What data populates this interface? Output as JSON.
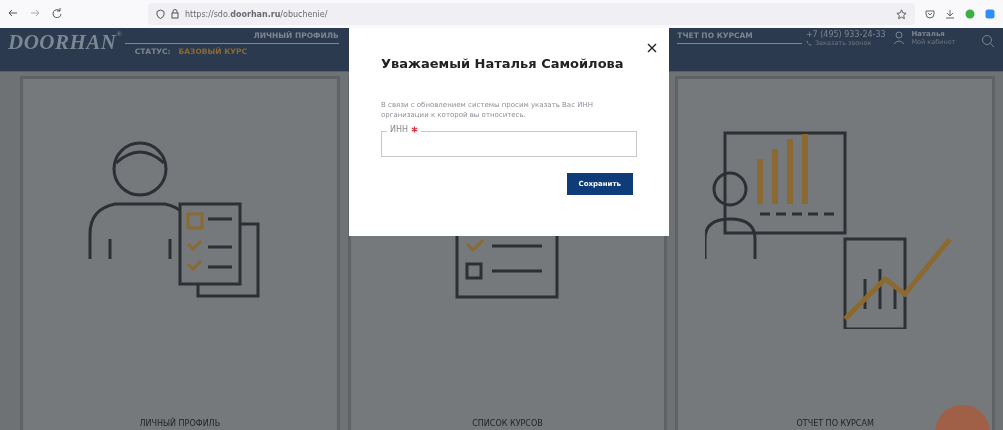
{
  "browser": {
    "url": "https://sdo.**doorhan.ru**/obuchenie/"
  },
  "header": {
    "logo": "DOORHAN",
    "logo_mark": "®",
    "nav_top": "ЛИЧНЫЙ ПРОФИЛЬ",
    "status_label": "СТАТУС:",
    "status_value": "БАЗОВЫЙ КУРС",
    "nav_right": "ТЧЕТ ПО КУРСАМ",
    "phone": "+7 (495) 933-24-33",
    "callback": "Заказать звонок",
    "user_name": "Наталья",
    "user_link": "Мой кабинет"
  },
  "cards": [
    {
      "kind": "profile",
      "label": "ЛИЧНЫЙ ПРОФИЛЬ"
    },
    {
      "kind": "courses",
      "label": "СПИСОК КУРСОВ"
    },
    {
      "kind": "report",
      "label": "ОТЧЕТ ПО КУРСАМ"
    }
  ],
  "modal": {
    "title": "Уважаемый Наталья Самойлова",
    "message": "В связи с обновлением системы просим указать Вас ИНН организации к которой вы относитесь.",
    "field": {
      "label": "ИНН",
      "required": true
    },
    "button": "Сохранить"
  }
}
